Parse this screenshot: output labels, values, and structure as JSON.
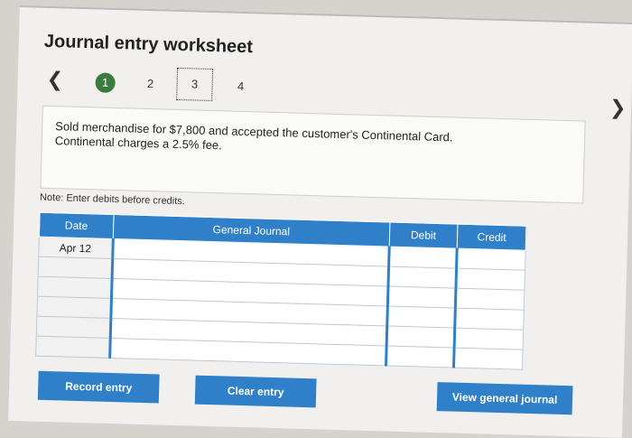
{
  "title": "Journal entry worksheet",
  "nav": {
    "prev_icon": "chevron-left-icon",
    "next_icon": "chevron-right-icon"
  },
  "steps": [
    {
      "label": "1",
      "state": "active"
    },
    {
      "label": "2",
      "state": "default"
    },
    {
      "label": "3",
      "state": "current"
    },
    {
      "label": "4",
      "state": "default"
    }
  ],
  "prompt": {
    "line1": "Sold merchandise for $7,800 and accepted the customer's Continental Card.",
    "line2": "Continental charges a 2.5% fee."
  },
  "note": "Note: Enter debits before credits.",
  "journal": {
    "headers": {
      "date": "Date",
      "general_journal": "General Journal",
      "debit": "Debit",
      "credit": "Credit"
    },
    "rows": [
      {
        "date": "Apr 12",
        "account": "",
        "debit": "",
        "credit": ""
      },
      {
        "date": "",
        "account": "",
        "debit": "",
        "credit": ""
      },
      {
        "date": "",
        "account": "",
        "debit": "",
        "credit": ""
      },
      {
        "date": "",
        "account": "",
        "debit": "",
        "credit": ""
      },
      {
        "date": "",
        "account": "",
        "debit": "",
        "credit": ""
      },
      {
        "date": "",
        "account": "",
        "debit": "",
        "credit": ""
      }
    ]
  },
  "buttons": {
    "record": "Record entry",
    "clear": "Clear entry",
    "view": "View general journal"
  },
  "colors": {
    "accent": "#2f80c9",
    "step_active": "#3b7a3f"
  }
}
